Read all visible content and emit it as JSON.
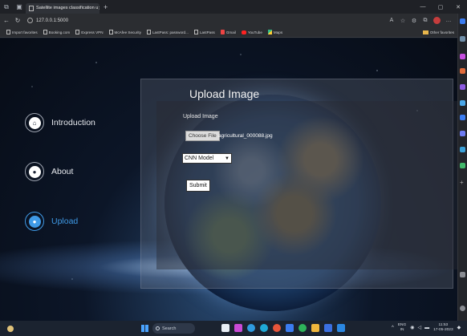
{
  "browser": {
    "tab_title": "Satellite images classification u",
    "url": "127.0.0.1:5000",
    "bookmarks": [
      "Import favorites",
      "Booking.com",
      "Express VPN",
      "McAfee Security",
      "LastPass: password...",
      "LastPass",
      "Gmail",
      "YouTube",
      "Maps"
    ],
    "other_favorites": "Other favorites"
  },
  "sidebar": {
    "items": [
      {
        "label": "Introduction",
        "icon": "home-icon",
        "glyph": "⌂"
      },
      {
        "label": "About",
        "icon": "users-icon",
        "glyph": "●"
      },
      {
        "label": "Upload",
        "icon": "user-icon",
        "glyph": "●"
      }
    ],
    "active": "Upload",
    "accent_color": "#3f9ae6"
  },
  "upload_form": {
    "title": "Upload Image",
    "field_label": "Upload Image",
    "choose_file_label": "Choose File",
    "file_name": "agricultural_000088.jpg",
    "model_selected": "CNN Model",
    "submit_label": "Submit"
  },
  "taskbar": {
    "search_placeholder": "Search",
    "language_top": "ENG",
    "language_bottom": "IN",
    "time": "11:53",
    "date": "17-05-2023"
  }
}
